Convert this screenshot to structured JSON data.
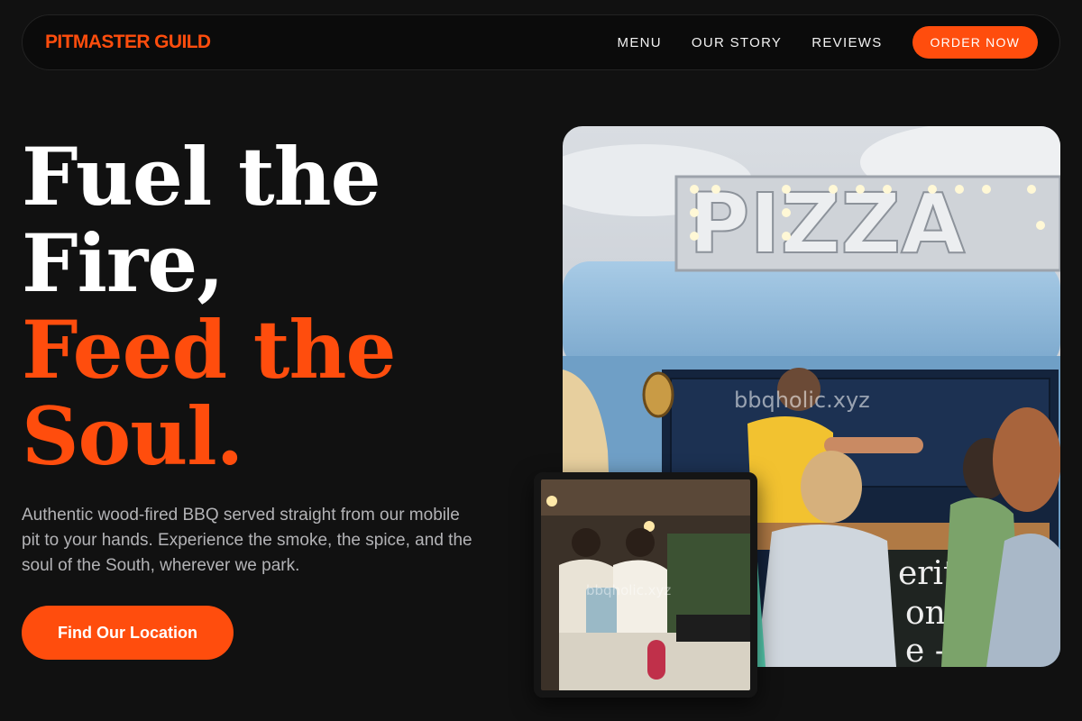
{
  "brand": {
    "name": "PITMASTER GUILD",
    "accent": "#ff4d0d"
  },
  "nav": {
    "links": [
      "MENU",
      "OUR STORY",
      "REVIEWS"
    ],
    "cta": "ORDER NOW"
  },
  "hero": {
    "headline_white": [
      "Fuel the",
      "Fire,"
    ],
    "headline_orange": [
      "Feed the",
      "Soul."
    ],
    "description": "Authentic wood-fired BBQ served straight from our mobile pit to your hands. Experience the smoke, the spice, and the soul of the South, wherever we park.",
    "cta": "Find Our Location"
  },
  "images": {
    "main_sign_text": "PIZZA",
    "main_watermark": "bbqholic.xyz",
    "main_board_text": [
      "erit",
      "oni",
      "e -"
    ],
    "inset_watermark": "bbqholic.xyz"
  }
}
